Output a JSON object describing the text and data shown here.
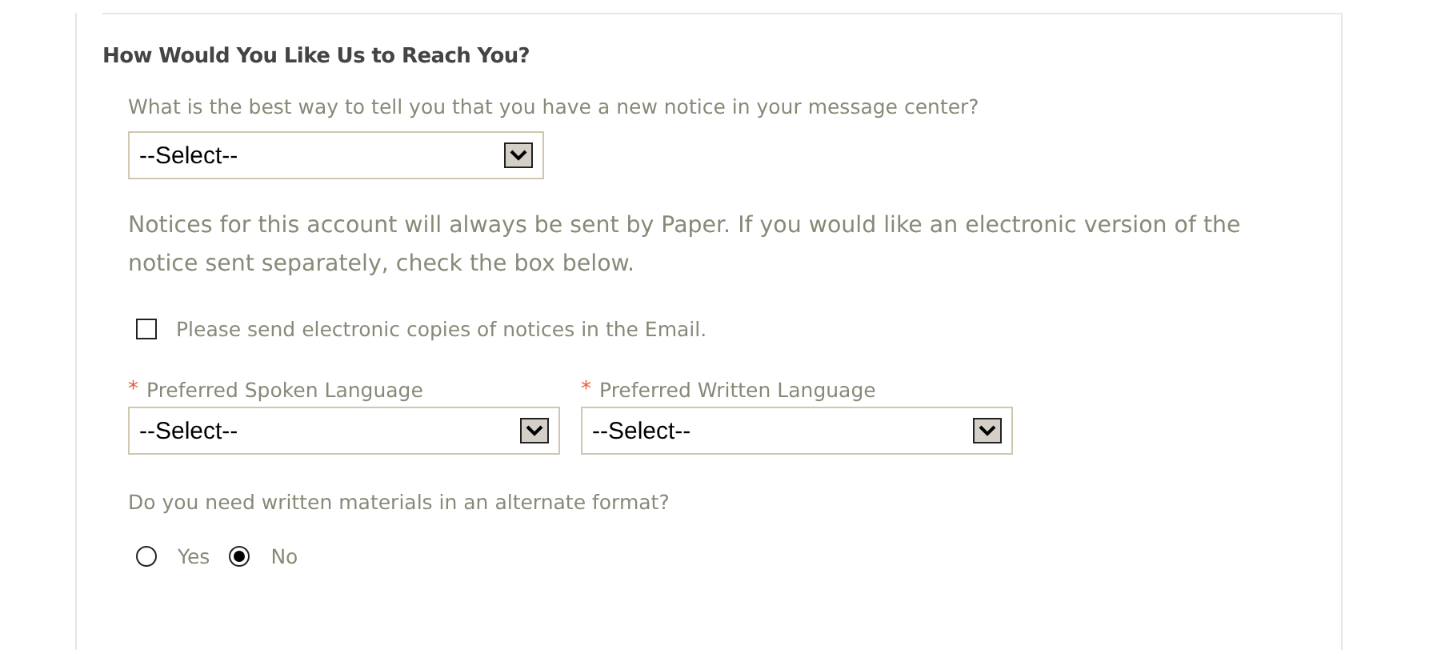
{
  "section": {
    "title": "How Would You Like Us to Reach You?"
  },
  "notice_method": {
    "label": "What is the best way to tell you that you have a new notice in your message center?",
    "value": "--Select--"
  },
  "paper_info": "Notices for this account will always be sent by Paper. If you would like an electronic version of the notice sent separately, check the box below.",
  "email_copies": {
    "label": "Please send electronic copies of notices in the Email.",
    "checked": false
  },
  "languages": [
    {
      "label": "Preferred Spoken Language",
      "required": true,
      "required_mark": "*",
      "value": "--Select--"
    },
    {
      "label": "Preferred Written Language",
      "required": true,
      "required_mark": "*",
      "value": "--Select--"
    }
  ],
  "alternate_format": {
    "question": "Do you need written materials in an alternate format?",
    "options": [
      {
        "label": "Yes",
        "selected": false
      },
      {
        "label": "No",
        "selected": true
      }
    ]
  }
}
